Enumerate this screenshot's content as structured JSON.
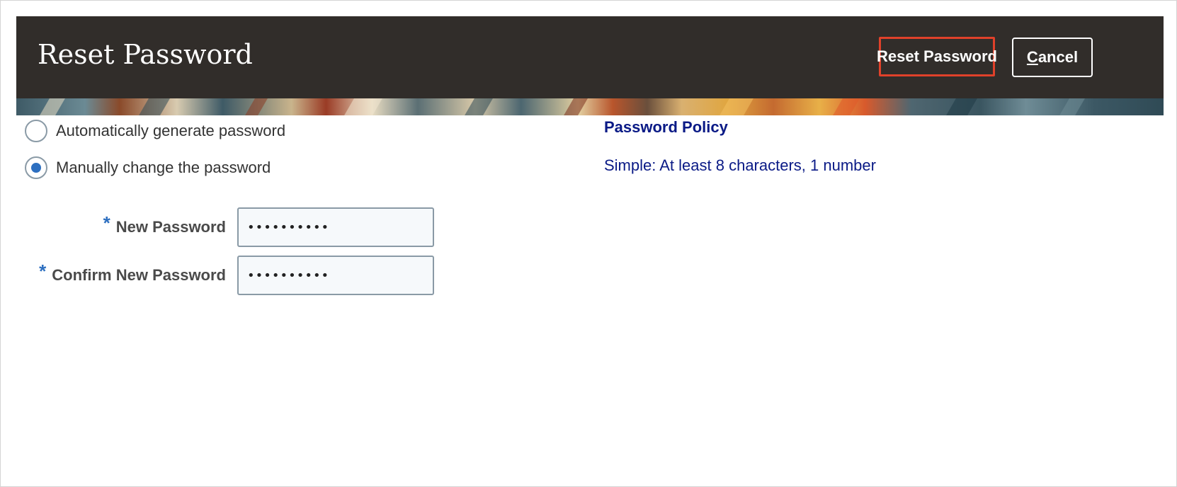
{
  "header": {
    "title": "Reset Password",
    "reset_button_label": "Reset Password",
    "cancel_button_accesskey": "C",
    "cancel_button_rest": "ancel"
  },
  "options": {
    "auto_generate": {
      "label": "Automatically generate password",
      "selected": false
    },
    "manual_change": {
      "label": "Manually change the password",
      "selected": true
    }
  },
  "form": {
    "required_marker": "*",
    "new_password": {
      "label": "New Password",
      "value": "••••••••••"
    },
    "confirm_password": {
      "label": "Confirm New Password",
      "value": "••••••••••"
    }
  },
  "policy": {
    "title": "Password Policy",
    "text": "Simple: At least 8 characters, 1 number"
  },
  "colors": {
    "header_bg": "#312d2a",
    "focus_outline": "#e0412a",
    "accent_blue": "#2d6fc0",
    "policy_text": "#0a1a86"
  }
}
